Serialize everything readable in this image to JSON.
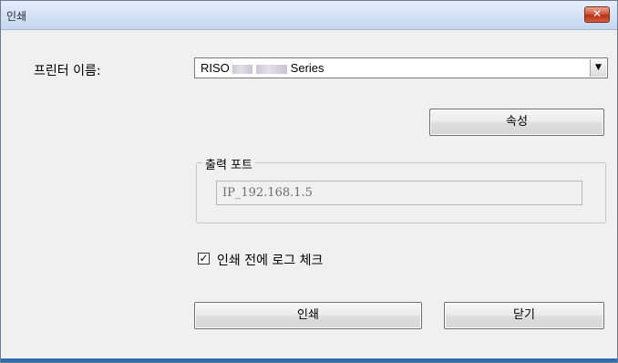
{
  "window": {
    "title": "인쇄",
    "close_symbol": "✕"
  },
  "printer": {
    "label": "프린터 이름:",
    "selected_prefix": "RISO",
    "selected_suffix": "Series",
    "dropdown_arrow": "▼"
  },
  "buttons": {
    "properties": "속성",
    "print": "인쇄",
    "close": "닫기"
  },
  "output_port": {
    "group_title": "출력 포트",
    "value": "IP_192.168.1.5"
  },
  "log_check": {
    "label": "인쇄 전에 로그 체크",
    "checked": true,
    "check_mark": "✓"
  },
  "colors": {
    "title_bar": "#d3e1f4",
    "close_button": "#c9452a",
    "dialog_bg": "#f0f0f0"
  }
}
